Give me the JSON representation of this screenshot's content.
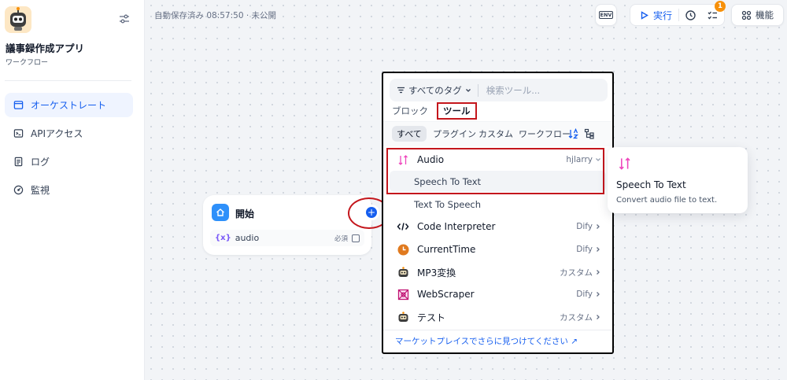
{
  "sidebar": {
    "app_name": "議事録作成アプリ",
    "app_type": "ワークフロー",
    "nav": [
      {
        "label": "オーケストレート",
        "icon": "layout-icon",
        "active": true
      },
      {
        "label": "APIアクセス",
        "icon": "terminal-icon",
        "active": false
      },
      {
        "label": "ログ",
        "icon": "file-list-icon",
        "active": false
      },
      {
        "label": "監視",
        "icon": "dashboard-gauge-icon",
        "active": false
      }
    ]
  },
  "header": {
    "autosave": "自動保存済み 08:57:50 · 未公開",
    "env_label": "ENV",
    "run_label": "実行",
    "checklist_count": "1",
    "features_label": "機能"
  },
  "start_node": {
    "title": "開始",
    "variable_name": "audio",
    "variable_required": "必須",
    "var_prefix": "{x}"
  },
  "picker": {
    "tag_filter": "すべてのタグ",
    "search_placeholder": "検索ツール...",
    "tabs": [
      "ブロック",
      "ツール"
    ],
    "active_tab": "ツール",
    "filters": [
      "すべて",
      "プラグイン",
      "カスタム",
      "ワークフロー"
    ],
    "active_filter": "すべて",
    "audio": {
      "name": "Audio",
      "author": "hjlarry"
    },
    "audio_tools": [
      "Speech To Text",
      "Text To Speech"
    ],
    "tools": [
      {
        "name": "Code Interpreter",
        "provider": "Dify",
        "icon": "code-icon"
      },
      {
        "name": "CurrentTime",
        "provider": "Dify",
        "icon": "clock-icon"
      },
      {
        "name": "MP3変換",
        "provider": "カスタム",
        "icon": "robot-avatar-icon"
      },
      {
        "name": "WebScraper",
        "provider": "Dify",
        "icon": "web-scraper-icon"
      },
      {
        "name": "テスト",
        "provider": "カスタム",
        "icon": "robot-avatar-icon"
      }
    ],
    "marketplace_link": "マーケットプレイスでさらに見つけてください ↗"
  },
  "tooltip": {
    "title": "Speech To Text",
    "description": "Convert audio file to text."
  },
  "colors": {
    "accent": "#155eef",
    "highlight": "#c4161c",
    "active_nav_bg": "#eff4ff",
    "badge": "#f79009"
  }
}
